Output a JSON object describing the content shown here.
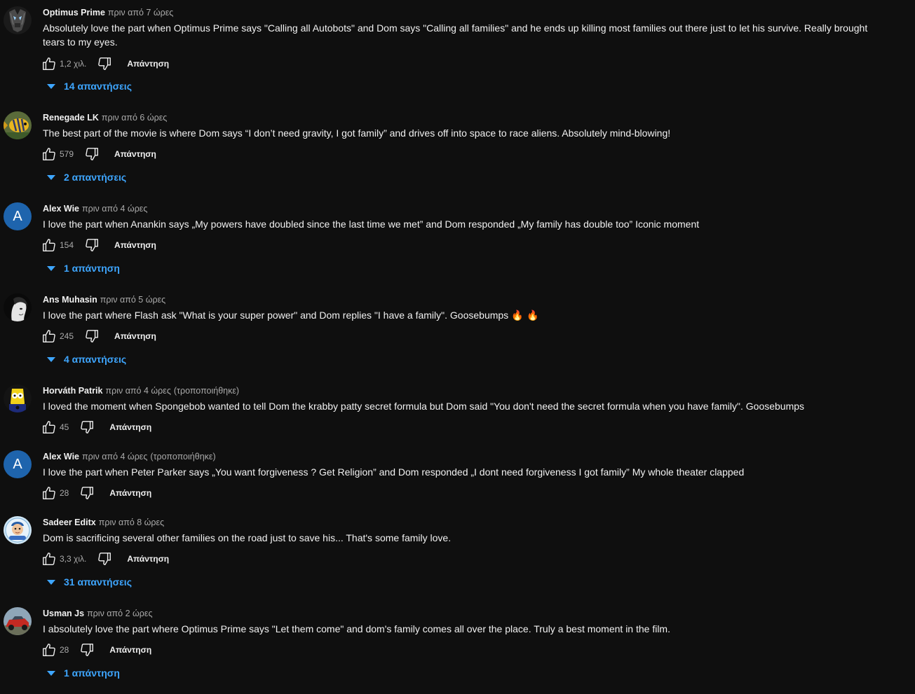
{
  "comments": [
    {
      "author": "Optimus Prime",
      "time": "πριν από 7 ώρες",
      "text": "Absolutely love the part when Optimus Prime says \"Calling all Autobots\" and Dom says \"Calling all families\" and he ends up killing most families out there just to let his survive. Really brought tears to my eyes.",
      "likes": "1,2 χιλ.",
      "reply_label": "Απάντηση",
      "replies_label": "14 απαντήσεις",
      "avatar_icon": "optimus-prime-avatar"
    },
    {
      "author": "Renegade LK",
      "time": "πριν από 6 ώρες",
      "text": "The best part of the movie is where Dom says “I don’t need gravity, I got family” and drives off into space to race aliens. Absolutely mind-blowing!",
      "likes": "579",
      "reply_label": "Απάντηση",
      "replies_label": "2 απαντήσεις",
      "avatar_icon": "fish-avatar"
    },
    {
      "author": "Alex Wie",
      "time": "πριν από 4 ώρες",
      "text": "I love the part when Anankin says „My powers have doubled since the last time we met” and Dom responded „My family has double too” Iconic moment",
      "likes": "154",
      "reply_label": "Απάντηση",
      "replies_label": "1 απάντηση",
      "avatar_letter": "A",
      "avatar_color": "#1e64ad"
    },
    {
      "author": "Ans Muhasin",
      "time": "πριν από 5 ώρες",
      "text": "I love the part where Flash ask \"What is your super power\" and Dom replies \"I have a family\". Goosebumps",
      "emoji": "🔥 🔥",
      "likes": "245",
      "reply_label": "Απάντηση",
      "replies_label": "4 απαντήσεις",
      "avatar_icon": "portrait-avatar"
    },
    {
      "author": "Horváth Patrik",
      "time": "πριν από 4 ώρες",
      "edited": "(τροποποιήθηκε)",
      "text": "I loved the moment when Spongebob wanted to tell Dom the krabby patty secret formula but Dom said \"You don't need the secret formula when you have family\". Goosebumps",
      "likes": "45",
      "reply_label": "Απάντηση",
      "avatar_icon": "cartoon-avatar"
    },
    {
      "author": "Alex Wie",
      "time": "πριν από 4 ώρες",
      "edited": "(τροποποιήθηκε)",
      "text": "I love the part when Peter Parker says „You want forgiveness ? Get Religion” and Dom responded „I dont need forgiveness I got family” My whole theater clapped",
      "likes": "28",
      "reply_label": "Απάντηση",
      "avatar_letter": "A",
      "avatar_color": "#1e64ad"
    },
    {
      "author": "Sadeer Editx",
      "time": "πριν από 8 ώρες",
      "text": "Dom is sacrificing several other families on the road just to save his... That's some family love.",
      "likes": "3,3 χιλ.",
      "reply_label": "Απάντηση",
      "replies_label": "31 απαντήσεις",
      "avatar_icon": "cartoon-character-avatar"
    },
    {
      "author": "Usman Js",
      "time": "πριν από 2 ώρες",
      "text": "I absolutely love the part where Optimus Prime says \"Let them come\" and dom's family comes all over the place. Truly a best moment in the film.",
      "likes": "28",
      "reply_label": "Απάντηση",
      "replies_label": "1 απάντηση",
      "avatar_icon": "car-avatar"
    }
  ],
  "colors": {
    "background": "#0f0f0f",
    "text": "#f1f1f1",
    "secondary_text": "#aaaaaa",
    "link_blue": "#3ea6ff"
  }
}
